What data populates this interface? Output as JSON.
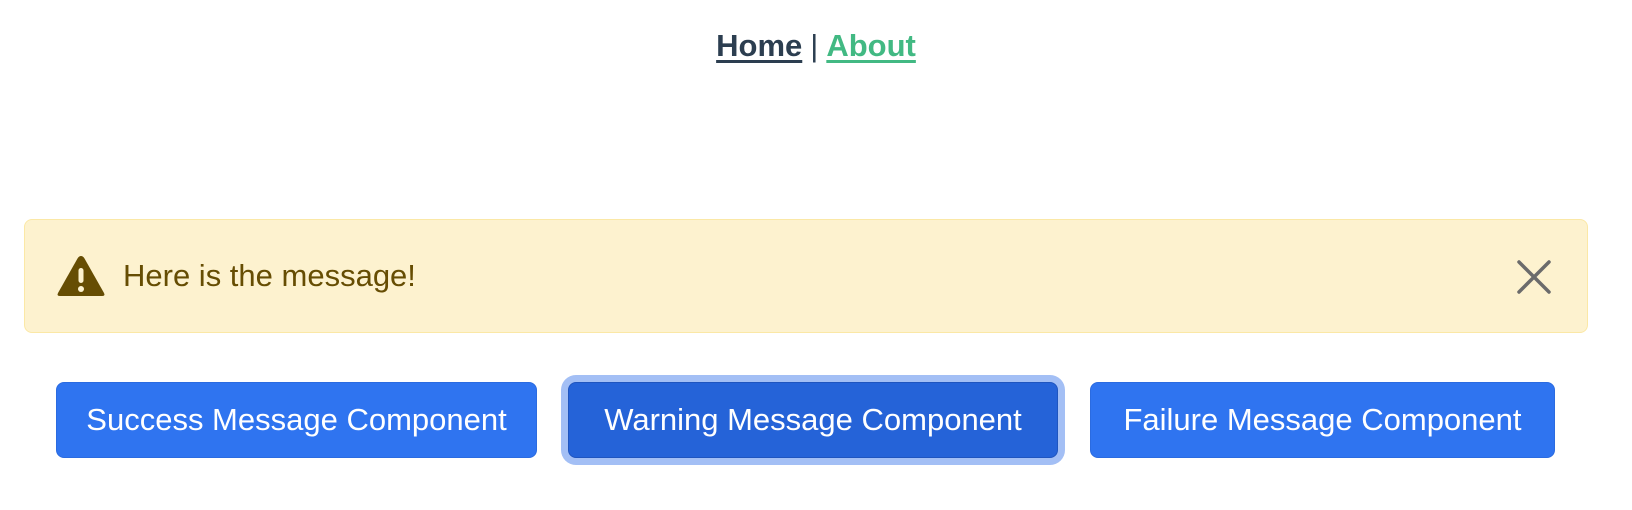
{
  "nav": {
    "home_label": "Home",
    "separator": "|",
    "about_label": "About"
  },
  "alert": {
    "type": "warning",
    "icon": "warning-triangle-icon",
    "message": "Here is the message!",
    "close_icon": "close-icon",
    "colors": {
      "background": "#fdf2cf",
      "text": "#664d03"
    }
  },
  "buttons": {
    "success_label": "Success Message Component",
    "warning_label": "Warning Message Component",
    "failure_label": "Failure Message Component",
    "focused": "warning",
    "color": "#2f74f0"
  }
}
